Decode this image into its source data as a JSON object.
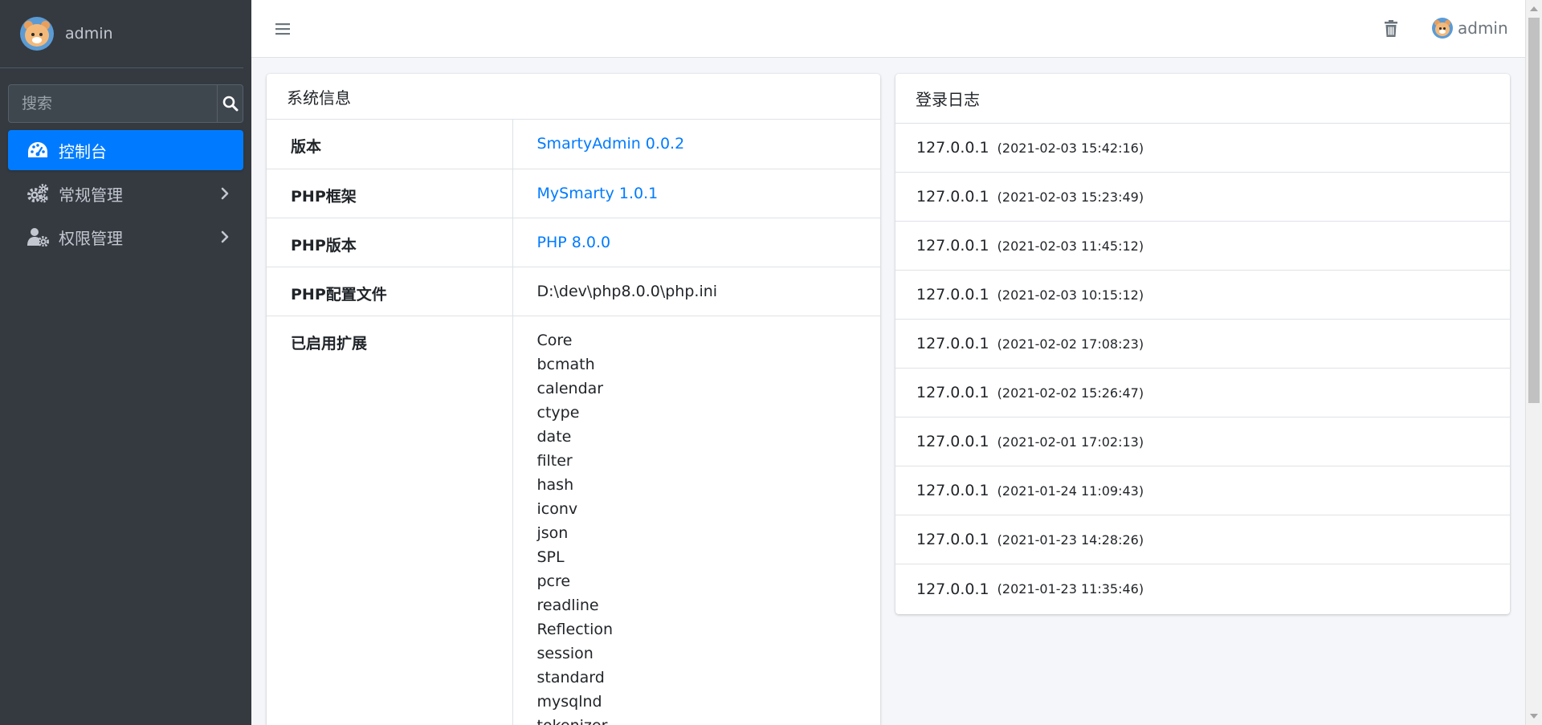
{
  "sidebar": {
    "user": {
      "name": "admin"
    },
    "search": {
      "placeholder": "搜索"
    },
    "nav": [
      {
        "label": "控制台",
        "icon": "dashboard-icon",
        "active": true
      },
      {
        "label": "常规管理",
        "icon": "cogs-icon",
        "has_children": true
      },
      {
        "label": "权限管理",
        "icon": "user-cog-icon",
        "has_children": true
      }
    ]
  },
  "topbar": {
    "user_name": "admin"
  },
  "system_info": {
    "title": "系统信息",
    "rows": [
      {
        "key": "版本",
        "value": "SmartyAdmin 0.0.2"
      },
      {
        "key": "PHP框架",
        "value": "MySmarty 1.0.1"
      },
      {
        "key": "PHP版本",
        "value": "PHP 8.0.0"
      },
      {
        "key": "PHP配置文件",
        "value": "D:\\dev\\php8.0.0\\php.ini"
      }
    ],
    "extensions_label": "已启用扩展",
    "extensions": [
      "Core",
      "bcmath",
      "calendar",
      "ctype",
      "date",
      "filter",
      "hash",
      "iconv",
      "json",
      "SPL",
      "pcre",
      "readline",
      "Reflection",
      "session",
      "standard",
      "mysqlnd",
      "tokenizer"
    ]
  },
  "login_log": {
    "title": "登录日志",
    "entries": [
      {
        "ip": "127.0.0.1",
        "time": "(2021-02-03 15:42:16)"
      },
      {
        "ip": "127.0.0.1",
        "time": "(2021-02-03 15:23:49)"
      },
      {
        "ip": "127.0.0.1",
        "time": "(2021-02-03 11:45:12)"
      },
      {
        "ip": "127.0.0.1",
        "time": "(2021-02-03 10:15:12)"
      },
      {
        "ip": "127.0.0.1",
        "time": "(2021-02-02 17:08:23)"
      },
      {
        "ip": "127.0.0.1",
        "time": "(2021-02-02 15:26:47)"
      },
      {
        "ip": "127.0.0.1",
        "time": "(2021-02-01 17:02:13)"
      },
      {
        "ip": "127.0.0.1",
        "time": "(2021-01-24 11:09:43)"
      },
      {
        "ip": "127.0.0.1",
        "time": "(2021-01-23 14:28:26)"
      },
      {
        "ip": "127.0.0.1",
        "time": "(2021-01-23 11:35:46)"
      }
    ]
  },
  "colors": {
    "sidebar_bg": "#343a40",
    "primary": "#007bff",
    "page_bg": "#f4f6f9"
  }
}
